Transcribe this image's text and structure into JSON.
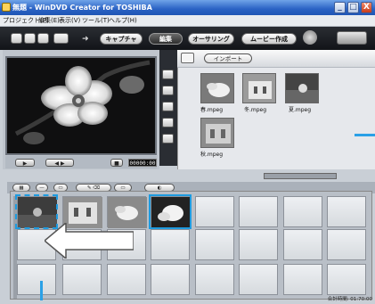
{
  "window": {
    "title": "無題 - WinDVD Creator for TOSHIBA",
    "controls": [
      "_",
      "□",
      "X"
    ]
  },
  "menu": [
    "プロジェクト(P)",
    "編集(E)",
    "表示(V)",
    "ツール(T)",
    "ヘルプ(H)"
  ],
  "modes": [
    {
      "label": "キャプチャ",
      "active": false
    },
    {
      "label": "編集",
      "active": true
    },
    {
      "label": "オーサリング",
      "active": false
    },
    {
      "label": "ムービー作成",
      "active": false
    }
  ],
  "library": {
    "import_label": "インポート",
    "items": [
      {
        "label": "春.mpeg"
      },
      {
        "label": "冬.mpeg"
      },
      {
        "label": "夏.mpeg"
      },
      {
        "label": "秋.mpeg"
      }
    ]
  },
  "player": {
    "timecode": "00000:00"
  },
  "status": {
    "total_time": "合計時間: 01:70:00"
  },
  "colors": {
    "accent": "#1e9be0",
    "toolbar_dark": "#1b1d22",
    "title_blue": "#2a62c4"
  }
}
